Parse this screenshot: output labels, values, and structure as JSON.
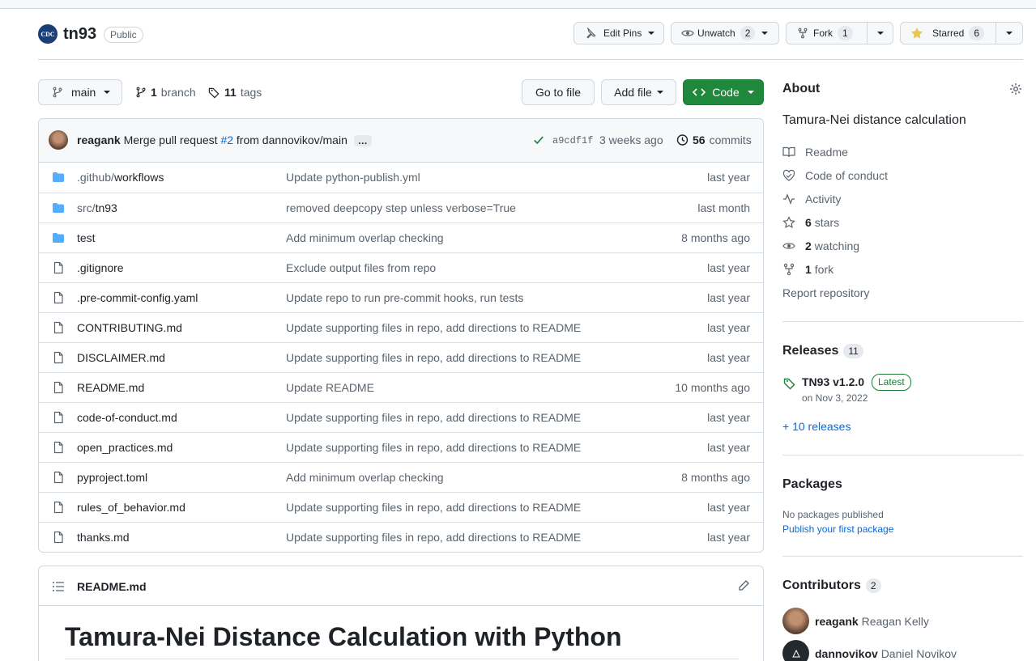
{
  "repo": {
    "logo_text": "CDC",
    "name": "tn93",
    "visibility": "Public",
    "edit_pins": "Edit Pins",
    "unwatch": {
      "label": "Unwatch",
      "count": "2"
    },
    "fork": {
      "label": "Fork",
      "count": "1"
    },
    "star": {
      "label": "Starred",
      "count": "6"
    }
  },
  "toolbar": {
    "branch": "main",
    "branches": {
      "count": "1",
      "label": "branch"
    },
    "tags": {
      "count": "11",
      "label": "tags"
    },
    "go_to_file": "Go to file",
    "add_file": "Add file",
    "code": "Code"
  },
  "commit": {
    "author": "reagank",
    "message_pre": "Merge pull request",
    "pr": "#2",
    "message_post": "from dannovikov/main",
    "ellipsis": "…",
    "sha": "a9cdf1f",
    "age": "3 weeks ago",
    "commits_count": "56",
    "commits_label": "commits"
  },
  "files": [
    {
      "type": "dir",
      "dim": ".github/",
      "name": "workflows",
      "msg": "Update python-publish.yml",
      "age": "last year"
    },
    {
      "type": "dir",
      "dim": "src/",
      "name": "tn93",
      "msg": "removed deepcopy step unless verbose=True",
      "age": "last month"
    },
    {
      "type": "dir",
      "dim": "",
      "name": "test",
      "msg": "Add minimum overlap checking",
      "age": "8 months ago"
    },
    {
      "type": "file",
      "dim": "",
      "name": ".gitignore",
      "msg": "Exclude output files from repo",
      "age": "last year"
    },
    {
      "type": "file",
      "dim": "",
      "name": ".pre-commit-config.yaml",
      "msg": "Update repo to run pre-commit hooks, run tests",
      "age": "last year"
    },
    {
      "type": "file",
      "dim": "",
      "name": "CONTRIBUTING.md",
      "msg": "Update supporting files in repo, add directions to README",
      "age": "last year"
    },
    {
      "type": "file",
      "dim": "",
      "name": "DISCLAIMER.md",
      "msg": "Update supporting files in repo, add directions to README",
      "age": "last year"
    },
    {
      "type": "file",
      "dim": "",
      "name": "README.md",
      "msg": "Update README",
      "age": "10 months ago"
    },
    {
      "type": "file",
      "dim": "",
      "name": "code-of-conduct.md",
      "msg": "Update supporting files in repo, add directions to README",
      "age": "last year"
    },
    {
      "type": "file",
      "dim": "",
      "name": "open_practices.md",
      "msg": "Update supporting files in repo, add directions to README",
      "age": "last year"
    },
    {
      "type": "file",
      "dim": "",
      "name": "pyproject.toml",
      "msg": "Add minimum overlap checking",
      "age": "8 months ago"
    },
    {
      "type": "file",
      "dim": "",
      "name": "rules_of_behavior.md",
      "msg": "Update supporting files in repo, add directions to README",
      "age": "last year"
    },
    {
      "type": "file",
      "dim": "",
      "name": "thanks.md",
      "msg": "Update supporting files in repo, add directions to README",
      "age": "last year"
    }
  ],
  "readme": {
    "filename": "README.md",
    "heading": "Tamura-Nei Distance Calculation with Python"
  },
  "about": {
    "title": "About",
    "description": "Tamura-Nei distance calculation",
    "readme": "Readme",
    "code_of_conduct": "Code of conduct",
    "activity": "Activity",
    "stars": {
      "count": "6",
      "label": "stars"
    },
    "watching": {
      "count": "2",
      "label": "watching"
    },
    "forks": {
      "count": "1",
      "label": "fork"
    },
    "report": "Report repository"
  },
  "releases": {
    "title": "Releases",
    "count": "11",
    "latest_name": "TN93 v1.2.0",
    "latest_badge": "Latest",
    "latest_date": "on Nov 3, 2022",
    "more": "+ 10 releases"
  },
  "packages": {
    "title": "Packages",
    "none": "No packages published",
    "publish": "Publish your first package"
  },
  "contributors": {
    "title": "Contributors",
    "count": "2",
    "list": [
      {
        "login": "reagank",
        "name": "Reagan Kelly"
      },
      {
        "login": "dannovikov",
        "name": "Daniel Novikov"
      }
    ]
  },
  "colors": {
    "accent": "#1f883d",
    "link": "#0969da",
    "folder": "#54aeff",
    "star": "#eac54f"
  }
}
